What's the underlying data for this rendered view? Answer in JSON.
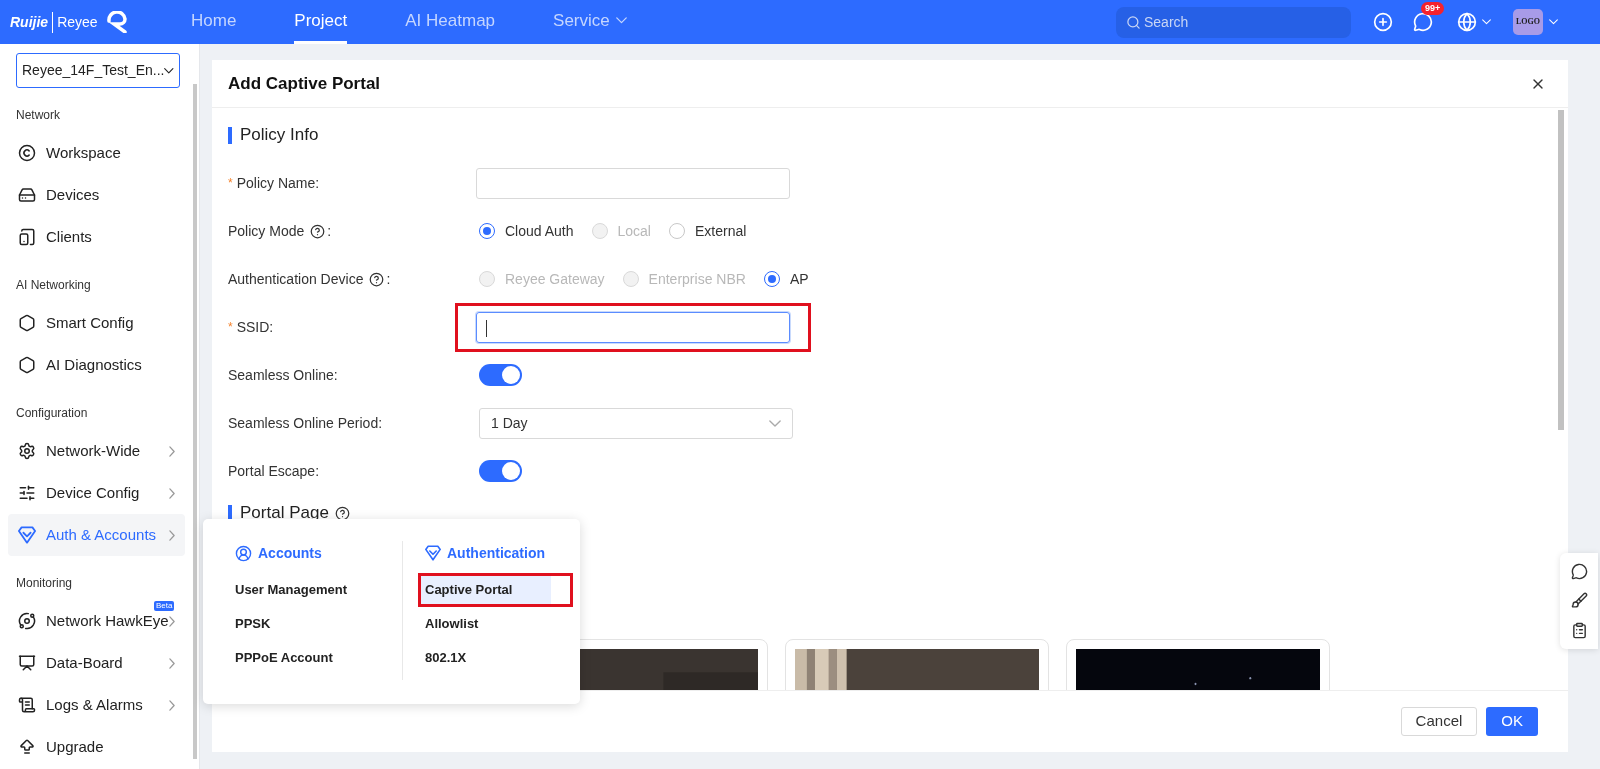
{
  "top_bar": {
    "brand": "Ruijie",
    "brand_product": "Reyee",
    "nav": [
      {
        "label": "Home",
        "selected": false,
        "dropdown": false
      },
      {
        "label": "Project",
        "selected": true,
        "dropdown": false
      },
      {
        "label": "AI Heatmap",
        "selected": false,
        "dropdown": false
      },
      {
        "label": "Service",
        "selected": false,
        "dropdown": true
      }
    ],
    "search": {
      "placeholder": "Search"
    },
    "message_badge": "99+",
    "avatar": "LOGO"
  },
  "sidebar": {
    "project": "Reyee_14F_Test_En...",
    "sections": [
      {
        "title": "Network",
        "items": [
          {
            "label": "Workspace",
            "selected": false,
            "submenu": false
          },
          {
            "label": "Devices",
            "selected": false,
            "submenu": false
          },
          {
            "label": "Clients",
            "selected": false,
            "submenu": false
          }
        ]
      },
      {
        "title": "AI Networking",
        "items": [
          {
            "label": "Smart Config",
            "selected": false,
            "submenu": false
          },
          {
            "label": "AI Diagnostics",
            "selected": false,
            "submenu": false
          }
        ]
      },
      {
        "title": "Configuration",
        "items": [
          {
            "label": "Network-Wide",
            "selected": false,
            "submenu": true
          },
          {
            "label": "Device Config",
            "selected": false,
            "submenu": true
          },
          {
            "label": "Auth & Accounts",
            "selected": true,
            "submenu": true
          }
        ]
      },
      {
        "title": "Monitoring",
        "items": [
          {
            "label": "Network HawkEye",
            "selected": false,
            "submenu": true,
            "badge": "Beta"
          },
          {
            "label": "Data-Board",
            "selected": false,
            "submenu": true
          },
          {
            "label": "Logs & Alarms",
            "selected": false,
            "submenu": true
          },
          {
            "label": "Upgrade",
            "selected": false,
            "submenu": false
          }
        ]
      }
    ]
  },
  "modal": {
    "title": "Add Captive Portal",
    "form": [
      {
        "kind": "section",
        "label": "Policy Info",
        "help": false
      },
      {
        "kind": "text",
        "marker": "*",
        "label": "Policy Name:",
        "help": false,
        "focused": false,
        "annotated": false
      },
      {
        "kind": "radio",
        "label": "Policy Mode",
        "help": true,
        "suffix": ":",
        "options": [
          {
            "label": "Cloud Auth",
            "selected": true,
            "disabled": false
          },
          {
            "label": "Local",
            "selected": false,
            "disabled": true
          },
          {
            "label": "External",
            "selected": false,
            "disabled": false
          }
        ]
      },
      {
        "kind": "radio",
        "label": "Authentication Device",
        "help": true,
        "suffix": ":",
        "options": [
          {
            "label": "Reyee Gateway",
            "selected": false,
            "disabled": true
          },
          {
            "label": "Enterprise NBR",
            "selected": false,
            "disabled": true
          },
          {
            "label": "AP",
            "selected": true,
            "disabled": false
          }
        ]
      },
      {
        "kind": "text",
        "marker": "*",
        "label": "SSID:",
        "help": false,
        "focused": true,
        "annotated": true
      },
      {
        "kind": "toggle",
        "label": "Seamless Online:",
        "help": false,
        "on": true
      },
      {
        "kind": "select",
        "label": "Seamless Online Period:",
        "help": false,
        "value": "1 Day"
      },
      {
        "kind": "toggle",
        "label": "Portal Escape:",
        "help": false,
        "on": true
      },
      {
        "kind": "section",
        "label": "Portal Page",
        "help": true
      }
    ],
    "buttons": [
      {
        "label": "Cancel",
        "primary": false
      },
      {
        "label": "OK",
        "primary": true
      }
    ]
  },
  "menu": {
    "columns": [
      {
        "title": "Accounts",
        "items": [
          {
            "label": "User Management",
            "selected": false,
            "annotated": false
          },
          {
            "label": "PPSK",
            "selected": false,
            "annotated": false
          },
          {
            "label": "PPPoE Account",
            "selected": false,
            "annotated": false
          }
        ]
      },
      {
        "title": "Authentication",
        "items": [
          {
            "label": "Captive Portal",
            "selected": true,
            "annotated": true
          },
          {
            "label": "Allowlist",
            "selected": false,
            "annotated": false
          },
          {
            "label": "802.1X",
            "selected": false,
            "annotated": false
          }
        ]
      }
    ]
  }
}
